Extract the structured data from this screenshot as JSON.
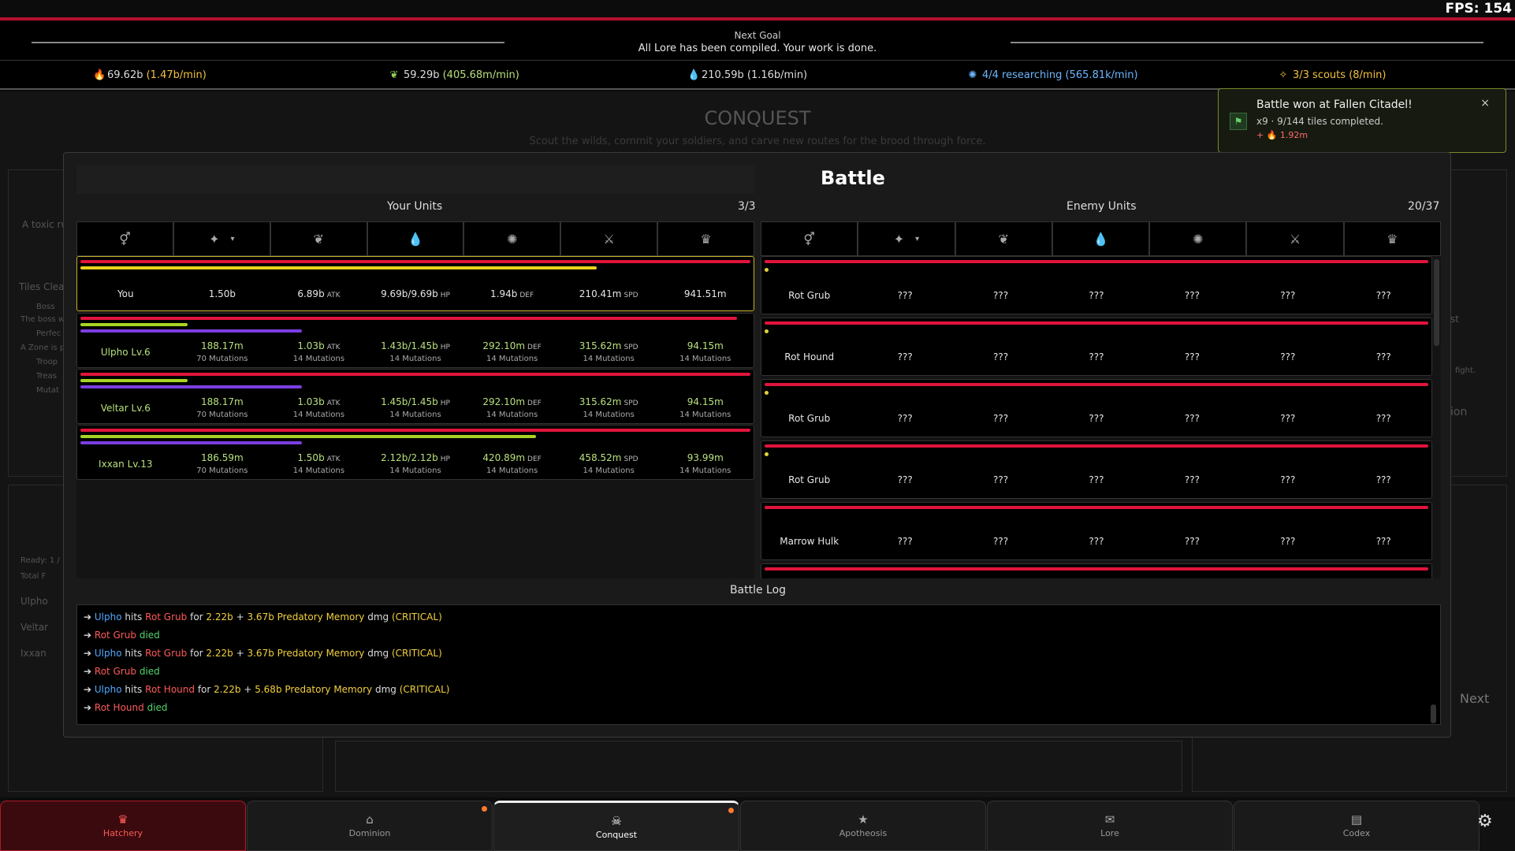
{
  "fps": "FPS: 154",
  "goal": {
    "label": "Next Goal",
    "text": "All Lore has been compiled. Your work is done."
  },
  "resources": [
    {
      "icon": "flame-icon",
      "value": "69.62b",
      "rate": "(1.47b/min)"
    },
    {
      "icon": "leaf-icon",
      "value": "59.29b",
      "rate": "(405.68m/min)"
    },
    {
      "icon": "drop-icon",
      "value": "210.59b",
      "rate": "(1.16b/min)"
    },
    {
      "icon": "research-icon",
      "value": "4/4 researching",
      "rate": "(565.81k/min)"
    },
    {
      "icon": "scout-icon",
      "value": "3/3 scouts",
      "rate": "(8/min)"
    }
  ],
  "background": {
    "title": "CONQUEST",
    "subtitle": "Scout the wilds, commit your soldiers, and carve new routes for the brood through force.",
    "left_text": [
      "A toxic ru",
      "Tiles Clea",
      "Boss",
      "The boss w",
      "Perfec",
      "A Zone is p",
      "Troop",
      "Treas",
      "Mutat",
      "Ready: 1 /",
      "Total F",
      "Ulpho",
      "Veltar",
      "Ixxan"
    ],
    "right_text": [
      "st",
      "fight.",
      "ion",
      "Next"
    ]
  },
  "battle": {
    "title": "Battle",
    "your_units": {
      "label": "Your Units",
      "count": "3/3"
    },
    "enemy_units": {
      "label": "Enemy Units",
      "count": "20/37"
    },
    "column_icons": [
      "gender-icon",
      "sparkle-icon",
      "wings-icon",
      "drop-icon",
      "brain-icon",
      "blade-icon",
      "crown-icon"
    ],
    "units": [
      {
        "name": "You",
        "c1": "1.50b",
        "atk": "6.89b",
        "hp": "9.69b/9.69b",
        "def": "1.94b",
        "spd": "210.41m",
        "last": "941.51m",
        "muts": [
          "",
          "",
          "",
          "",
          "",
          ""
        ]
      },
      {
        "name": "Ulpho Lv.6",
        "c1": "188.17m",
        "atk": "1.03b",
        "hp": "1.43b/1.45b",
        "def": "292.10m",
        "spd": "315.62m",
        "last": "94.15m",
        "muts": [
          "70 Mutations",
          "14 Mutations",
          "14 Mutations",
          "14 Mutations",
          "14 Mutations",
          "14 Mutations"
        ]
      },
      {
        "name": "Veltar Lv.6",
        "c1": "188.17m",
        "atk": "1.03b",
        "hp": "1.45b/1.45b",
        "def": "292.10m",
        "spd": "315.62m",
        "last": "94.15m",
        "muts": [
          "70 Mutations",
          "14 Mutations",
          "14 Mutations",
          "14 Mutations",
          "14 Mutations",
          "14 Mutations"
        ]
      },
      {
        "name": "Ixxan Lv.13",
        "c1": "186.59m",
        "atk": "1.50b",
        "hp": "2.12b/2.12b",
        "def": "420.89m",
        "spd": "458.52m",
        "last": "93.99m",
        "muts": [
          "70 Mutations",
          "14 Mutations",
          "14 Mutations",
          "14 Mutations",
          "14 Mutations",
          "14 Mutations"
        ]
      }
    ],
    "units_bars": [
      {
        "hp": 1.0,
        "a": 0.77,
        "b": 0
      },
      {
        "hp": 0.98,
        "a": 0.16,
        "b": 0.33
      },
      {
        "hp": 1.0,
        "a": 0.16,
        "b": 0.33
      },
      {
        "hp": 1.0,
        "a": 0.68,
        "b": 0.33
      }
    ],
    "stat_suffix": {
      "atk": "ATK",
      "hp": "HP",
      "def": "DEF",
      "spd": "SPD"
    },
    "enemies": [
      {
        "name": "Rot Grub",
        "vals": [
          "???",
          "???",
          "???",
          "???",
          "???",
          "???"
        ]
      },
      {
        "name": "Rot Hound",
        "vals": [
          "???",
          "???",
          "???",
          "???",
          "???",
          "???"
        ]
      },
      {
        "name": "Rot Grub",
        "vals": [
          "???",
          "???",
          "???",
          "???",
          "???",
          "???"
        ]
      },
      {
        "name": "Rot Grub",
        "vals": [
          "???",
          "???",
          "???",
          "???",
          "???",
          "???"
        ]
      },
      {
        "name": "Marrow Hulk",
        "vals": [
          "???",
          "???",
          "???",
          "???",
          "???",
          "???"
        ]
      }
    ],
    "log_title": "Battle Log",
    "log": [
      {
        "type": "hit",
        "actor": "Ulpho",
        "target": "Rot Grub",
        "dmg": "2.22b",
        "bonus": "3.67b Predatory Memory",
        "crit": "(CRITICAL)"
      },
      {
        "type": "died",
        "target": "Rot Grub"
      },
      {
        "type": "hit",
        "actor": "Ulpho",
        "target": "Rot Grub",
        "dmg": "2.22b",
        "bonus": "3.67b Predatory Memory",
        "crit": "(CRITICAL)"
      },
      {
        "type": "died",
        "target": "Rot Grub"
      },
      {
        "type": "hit",
        "actor": "Ulpho",
        "target": "Rot Hound",
        "dmg": "2.22b",
        "bonus": "5.68b Predatory Memory",
        "crit": "(CRITICAL)"
      },
      {
        "type": "died",
        "target": "Rot Hound"
      }
    ],
    "log_words": {
      "arrow": "➔",
      "hits": "hits",
      "for": "for",
      "plus": "+",
      "dmg": "dmg",
      "died": "died"
    }
  },
  "toast": {
    "title": "Battle won at Fallen Citadel!",
    "sub": "x9 · 9/144 tiles completed.",
    "reward": "+ 🔥 1.92m",
    "close": "×"
  },
  "nav": [
    {
      "label": "Hatchery",
      "icon": "crown-icon",
      "glyph": "♛"
    },
    {
      "label": "Dominion",
      "icon": "home-icon",
      "glyph": "⌂"
    },
    {
      "label": "Conquest",
      "icon": "skull-icon",
      "glyph": "☠"
    },
    {
      "label": "Apotheosis",
      "icon": "star-icon",
      "glyph": "★"
    },
    {
      "label": "Lore",
      "icon": "scroll-icon",
      "glyph": "✉"
    },
    {
      "label": "Codex",
      "icon": "book-icon",
      "glyph": "▤"
    }
  ],
  "colors": {
    "accent_red": "#b3122d",
    "hp_bar": "#e0143c",
    "energy_bar": "#e8d21c",
    "xp_bar": "#7a3ee0",
    "crit_yellow": "#f2d03c",
    "unit_blue": "#4fa9ff",
    "enemy_red": "#ff5a5a",
    "died_green": "#53d46b"
  }
}
